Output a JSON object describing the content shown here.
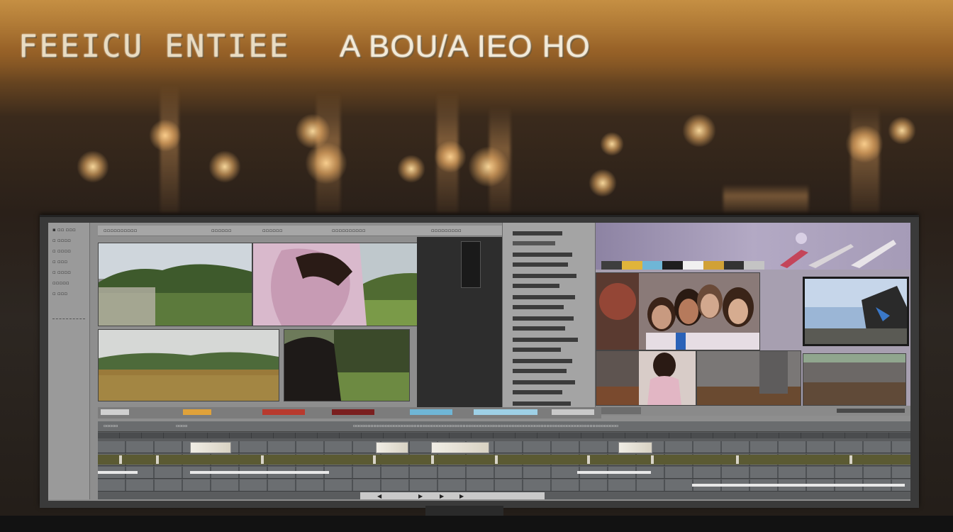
{
  "headline": {
    "left": "FEEICU ENTIEE",
    "right": "A BOU/A IEO HO"
  },
  "left_panel": {
    "items": [
      "▪ ▫▫ ▫▫▫",
      "▫ ▫▫▫▫",
      "▫ ▫▫▫▫",
      "▫ ▫▫▫",
      "▫ ▫▫▫▫",
      "▫▫▫▫▫",
      "▫ ▫▫▫"
    ]
  },
  "viewer_bar": {
    "labels": [
      "▫▫▫▫▫▫▫▫▫▫",
      "▫▫▫▫▫▫",
      "▫▫▫▫▫▫",
      "▫▫▫▫▫▫▫▫▫▫",
      "▫▫▫▫▫▫▫▫▫"
    ]
  },
  "timeline": {
    "header_labels": [
      "▫▫▫▫▫",
      "▫▫▫▫",
      "▫▫▫▫▫▫▫▫▫▫▫▫▫▫▫▫▫▫▫▫▫▫▫▫▫▫▫▫▫▫▫▫▫▫▫▫▫▫▫▫▫▫▫▫▫▫▫▫▫▫▫▫▫▫▫▫▫▫▫▫▫▫▫▫▫▫▫▫▫▫▫▫▫▫▫▫▫▫▫▫▫▫▫▫▫▫▫▫▫▫▫▫"
    ],
    "transport": [
      "◀",
      "▶",
      "▶",
      "▶"
    ]
  },
  "colors": {
    "accent_red": "#b83a2e",
    "accent_yellow": "#e0b43a",
    "accent_cyan": "#6fb6d6"
  }
}
